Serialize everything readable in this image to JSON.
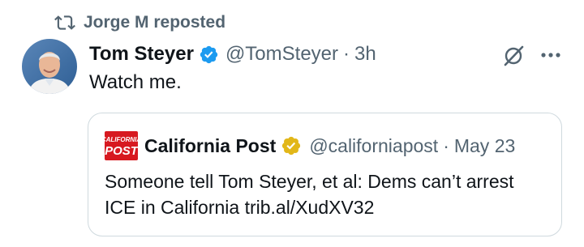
{
  "repost": {
    "icon": "repost-icon",
    "text": "Jorge M reposted"
  },
  "tweet": {
    "author_name": "Tom Steyer",
    "verified_icon": "verified-badge-icon",
    "verified_color": "#1d9bf0",
    "handle": "@TomSteyer",
    "separator": "·",
    "time": "3h",
    "text": "Watch me.",
    "actions": {
      "grok_icon": "grok-icon",
      "more_icon": "more-icon"
    }
  },
  "quoted": {
    "logo_icon": "california-post-logo",
    "logo_lines": [
      "CALIFORNIA",
      "POST"
    ],
    "author_name": "California Post",
    "verified_icon": "gold-verified-badge-icon",
    "verified_color": "#e2b719",
    "handle": "@californiapost",
    "separator": "·",
    "time": "May 23",
    "text": "Someone tell Tom Steyer, et al: Dems can’t arrest ICE in California trib.al/XudXV32"
  },
  "colors": {
    "primary_text": "#0f1419",
    "secondary_text": "#536471",
    "border": "#cfd9de",
    "logo_red": "#d71920"
  }
}
